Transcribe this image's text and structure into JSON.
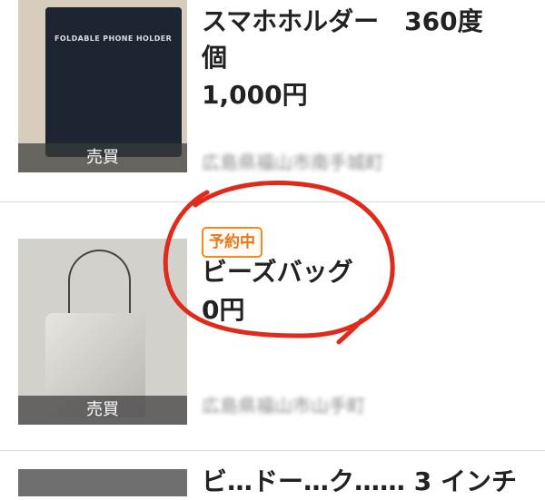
{
  "listings": [
    {
      "title": "スマホホルダー　360度　個",
      "title_line1": "スマホホルダー　360度",
      "title_line2": "個",
      "price": "1,000円",
      "tag": "売買",
      "location": "広島県福山市南手城町",
      "image_caption": "FOLDABLE PHONE HOLDER"
    },
    {
      "badge": "予約中",
      "title": "ビーズバッグ",
      "price": "0円",
      "tag": "売買",
      "location": "広島県福山市山手町"
    },
    {
      "title": "ビ…ドー…ク…… 3 インチ"
    }
  ],
  "colors": {
    "badge_border": "#f08a24",
    "annotation": "#e02a1b"
  }
}
